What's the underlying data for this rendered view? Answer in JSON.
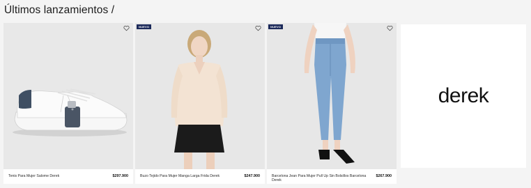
{
  "section": {
    "title": "Últimos lanzamientos /"
  },
  "products": [
    {
      "name": "Tenis Para Mujer Salome Derek",
      "price": "$297.900",
      "badge": ""
    },
    {
      "name": "Buzo Tejido Para Mujer Manga Larga Frida Derek",
      "price": "$247.900",
      "badge": "NUEVO"
    },
    {
      "name": "Barcelona Jean Para Mujer Pull Up Sin Bolsillos Barcelona Derek",
      "price": "$267.900",
      "badge": "NUEVO"
    }
  ],
  "brand": {
    "logo_text": "derek"
  },
  "icons": {
    "wishlist": "heart-outline-icon"
  },
  "colors": {
    "badge_bg": "#1c2a5a",
    "image_bg": "#e6e6e6",
    "page_bg": "#f4f4f4"
  }
}
